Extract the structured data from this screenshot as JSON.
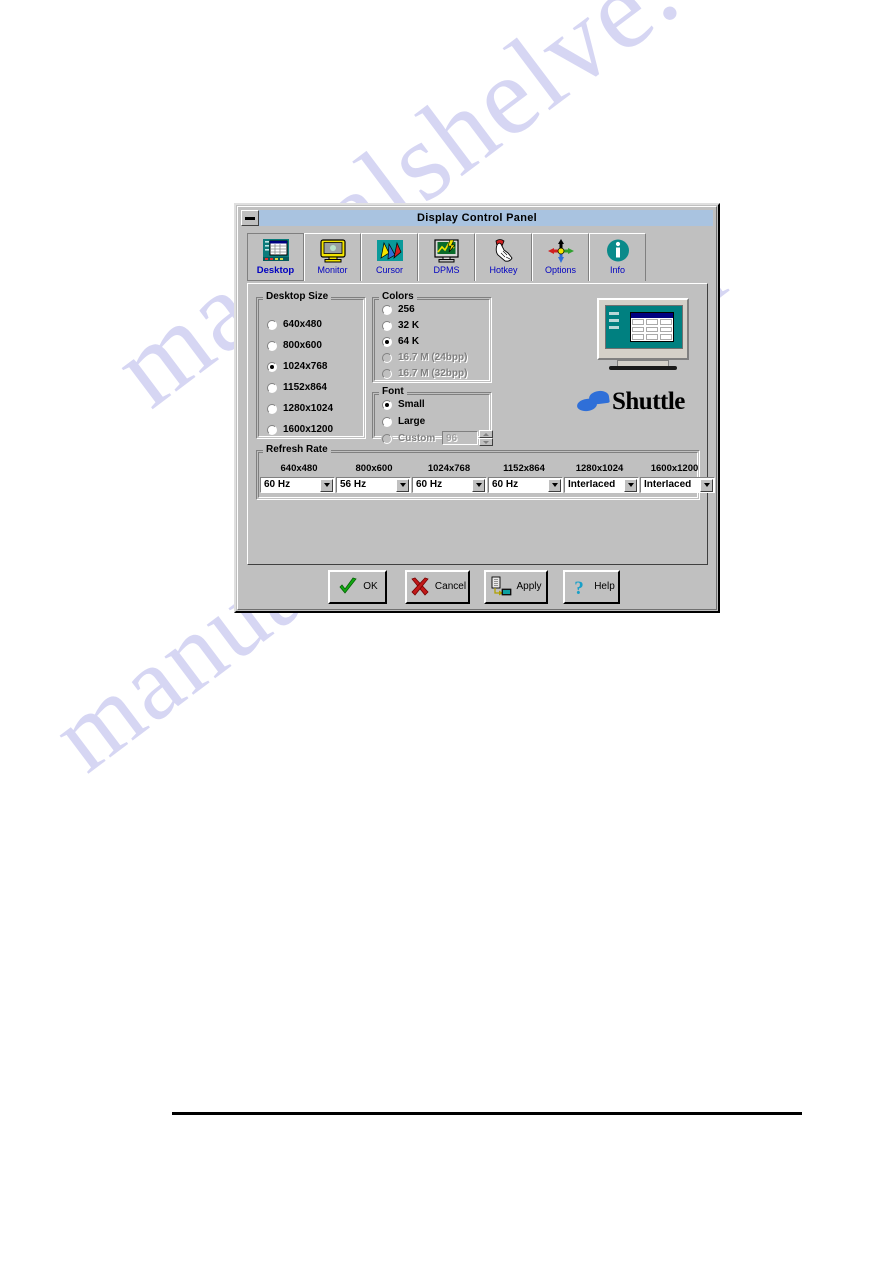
{
  "page": {
    "watermark_line1": "manualshelve.com",
    "watermark_line2": "manualshelve.com"
  },
  "window": {
    "title": "Display Control Panel",
    "sysmenu_icon": "minimize-box-icon"
  },
  "tabs": [
    {
      "label": "Desktop",
      "icon": "desktop-monitor-icon",
      "selected": true
    },
    {
      "label": "Monitor",
      "icon": "monitor-icon",
      "selected": false
    },
    {
      "label": "Cursor",
      "icon": "cursor-arrows-icon",
      "selected": false
    },
    {
      "label": "DPMS",
      "icon": "dpms-power-monitor-icon",
      "selected": false
    },
    {
      "label": "Hotkey",
      "icon": "hand-pointer-icon",
      "selected": false
    },
    {
      "label": "Options",
      "icon": "four-way-arrows-icon",
      "selected": false
    },
    {
      "label": "Info",
      "icon": "info-circle-icon",
      "selected": false
    }
  ],
  "desktop_size": {
    "caption": "Desktop Size",
    "options": [
      {
        "label": "640x480",
        "selected": false,
        "disabled": false
      },
      {
        "label": "800x600",
        "selected": false,
        "disabled": false
      },
      {
        "label": "1024x768",
        "selected": true,
        "disabled": false
      },
      {
        "label": "1152x864",
        "selected": false,
        "disabled": false
      },
      {
        "label": "1280x1024",
        "selected": false,
        "disabled": false
      },
      {
        "label": "1600x1200",
        "selected": false,
        "disabled": false
      }
    ]
  },
  "colors": {
    "caption": "Colors",
    "options": [
      {
        "label": "256",
        "selected": false,
        "disabled": false
      },
      {
        "label": "32 K",
        "selected": false,
        "disabled": false
      },
      {
        "label": "64 K",
        "selected": true,
        "disabled": false
      },
      {
        "label": "16.7 M (24bpp)",
        "selected": false,
        "disabled": true
      },
      {
        "label": "16.7 M (32bpp)",
        "selected": false,
        "disabled": true
      }
    ]
  },
  "font": {
    "caption": "Font",
    "options": [
      {
        "label": "Small",
        "selected": true,
        "disabled": false
      },
      {
        "label": "Large",
        "selected": false,
        "disabled": false
      },
      {
        "label": "Custom",
        "selected": false,
        "disabled": true
      }
    ],
    "custom_value": "96"
  },
  "preview": {
    "monitor_icon": "desktop-preview-monitor-icon",
    "brand": "Shuttle",
    "brand_mark_icon": "shuttle-logo-icon"
  },
  "refresh_rate": {
    "caption": "Refresh Rate",
    "columns": [
      {
        "header": "640x480",
        "value": "60 Hz"
      },
      {
        "header": "800x600",
        "value": "56 Hz"
      },
      {
        "header": "1024x768",
        "value": "60 Hz"
      },
      {
        "header": "1152x864",
        "value": "60 Hz"
      },
      {
        "header": "1280x1024",
        "value": "Interlaced"
      },
      {
        "header": "1600x1200",
        "value": "Interlaced"
      }
    ]
  },
  "buttons": [
    {
      "label": "OK",
      "icon": "green-check-icon"
    },
    {
      "label": "Cancel",
      "icon": "red-x-icon"
    },
    {
      "label": "Apply",
      "icon": "apply-document-monitor-icon"
    },
    {
      "label": "Help",
      "icon": "question-mark-icon"
    }
  ],
  "colors_hex": {
    "face": "#c0c0c0",
    "titlebar": "#a9c3e0",
    "tab_label": "#0000c0",
    "brand_blue": "#2f6fd8",
    "screen_teal": "#008080"
  }
}
